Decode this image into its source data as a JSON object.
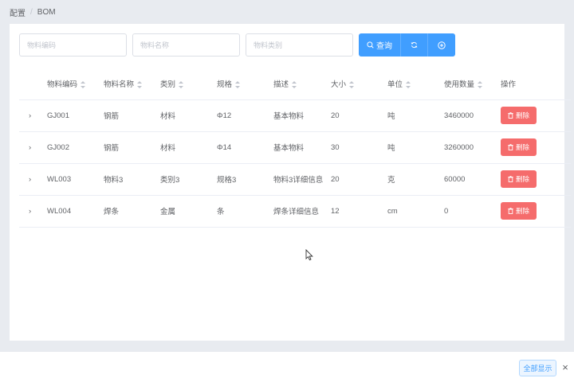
{
  "breadcrumb": {
    "parent": "配置",
    "separator": "/",
    "current": "BOM"
  },
  "search": {
    "code_placeholder": "物料编码",
    "name_placeholder": "物料名称",
    "category_placeholder": "物料类别",
    "query_label": "查询",
    "refresh_icon": "refresh-icon",
    "add_icon": "add-circle-icon"
  },
  "table": {
    "headers": {
      "code": "物料编码",
      "name": "物料名称",
      "category": "类别",
      "spec": "规格",
      "desc": "描述",
      "size": "大小",
      "unit": "单位",
      "qty": "使用数量",
      "action": "操作"
    },
    "rows": [
      {
        "code": "GJ001",
        "name": "钢筋",
        "category": "材料",
        "spec": "Φ12",
        "desc": "基本物料",
        "size": "20",
        "unit": "吨",
        "qty": "3460000",
        "action": "删除"
      },
      {
        "code": "GJ002",
        "name": "钢筋",
        "category": "材料",
        "spec": "Φ14",
        "desc": "基本物料",
        "size": "30",
        "unit": "吨",
        "qty": "3260000",
        "action": "删除"
      },
      {
        "code": "WL003",
        "name": "物料3",
        "category": "类别3",
        "spec": "规格3",
        "desc": "物料3详细信息",
        "size": "20",
        "unit": "克",
        "qty": "60000",
        "action": "删除"
      },
      {
        "code": "WL004",
        "name": "焊条",
        "category": "金属",
        "spec": "条",
        "desc": "焊条详细信息",
        "size": "12",
        "unit": "cm",
        "qty": "0",
        "action": "删除"
      }
    ]
  },
  "footer": {
    "show_all_label": "全部显示",
    "close_label": "×"
  },
  "colors": {
    "primary": "#409eff",
    "danger": "#f56c6c",
    "background": "#e8ebf0"
  }
}
